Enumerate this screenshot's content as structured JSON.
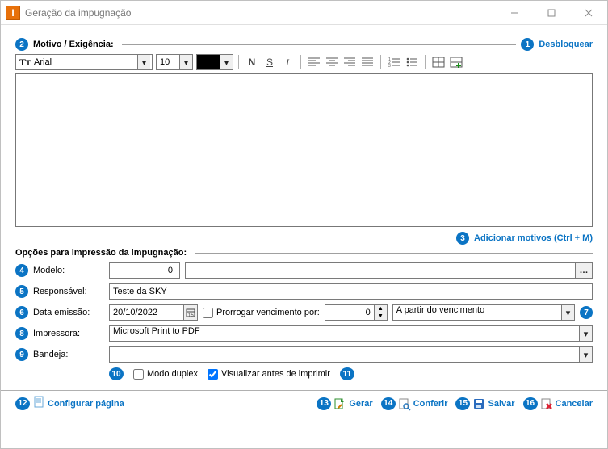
{
  "window": {
    "title": "Geração da impugnação"
  },
  "section1": {
    "label": "Motivo / Exigência:"
  },
  "unlock": {
    "label": "Desbloquear"
  },
  "toolbar": {
    "font_name": "Arial",
    "font_size": "10",
    "color": "#000000"
  },
  "textarea_value": "",
  "addmot": {
    "label": "Adicionar motivos (Ctrl + M)"
  },
  "section2": {
    "label": "Opções para impressão da impugnação:"
  },
  "fields": {
    "modelo": {
      "label": "Modelo:",
      "code": "0",
      "desc": ""
    },
    "responsavel": {
      "label": "Responsável:",
      "value": "Teste da SKY"
    },
    "data_emissao": {
      "label": "Data emissão:",
      "value": "20/10/2022"
    },
    "prorrogar": {
      "label": "Prorrogar vencimento por:",
      "checked": false,
      "value": "0"
    },
    "origem": {
      "value": "A partir do vencimento"
    },
    "impressora": {
      "label": "Impressora:",
      "value": "Microsoft Print to PDF"
    },
    "bandeja": {
      "label": "Bandeja:",
      "value": ""
    },
    "duplex": {
      "label": "Modo duplex",
      "checked": false
    },
    "visualizar": {
      "label": "Visualizar antes de imprimir",
      "checked": true
    }
  },
  "footer": {
    "configurar": "Configurar página",
    "gerar": "Gerar",
    "conferir": "Conferir",
    "salvar": "Salvar",
    "cancelar": "Cancelar"
  },
  "hints": {
    "n1": "1",
    "n2": "2",
    "n3": "3",
    "n4": "4",
    "n5": "5",
    "n6": "6",
    "n7": "7",
    "n8": "8",
    "n9": "9",
    "n10": "10",
    "n11": "11",
    "n12": "12",
    "n13": "13",
    "n14": "14",
    "n15": "15",
    "n16": "16"
  }
}
